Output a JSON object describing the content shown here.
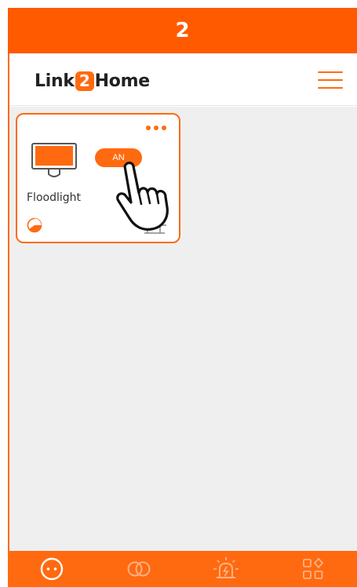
{
  "step": {
    "number": "2"
  },
  "header": {
    "brand_left": "Link",
    "brand_mid": "2",
    "brand_right": "Home",
    "menu_icon": "hamburger-menu-icon"
  },
  "device": {
    "name": "Floodlight",
    "toggle_label": "AN",
    "icon": "floodlight-icon",
    "more_icon": "more-dots-icon",
    "timer_icon": "timer-icon",
    "sensor_icon": "motion-sensor-icon"
  },
  "tabs": [
    {
      "icon": "devices-icon",
      "active": true
    },
    {
      "icon": "groups-icon",
      "active": false
    },
    {
      "icon": "alarm-icon",
      "active": false
    },
    {
      "icon": "more-apps-icon",
      "active": false
    }
  ],
  "colors": {
    "accent": "#ff6a10",
    "banner": "#ff5a00",
    "background": "#efefef",
    "inactive_tab": "#ffb184"
  }
}
